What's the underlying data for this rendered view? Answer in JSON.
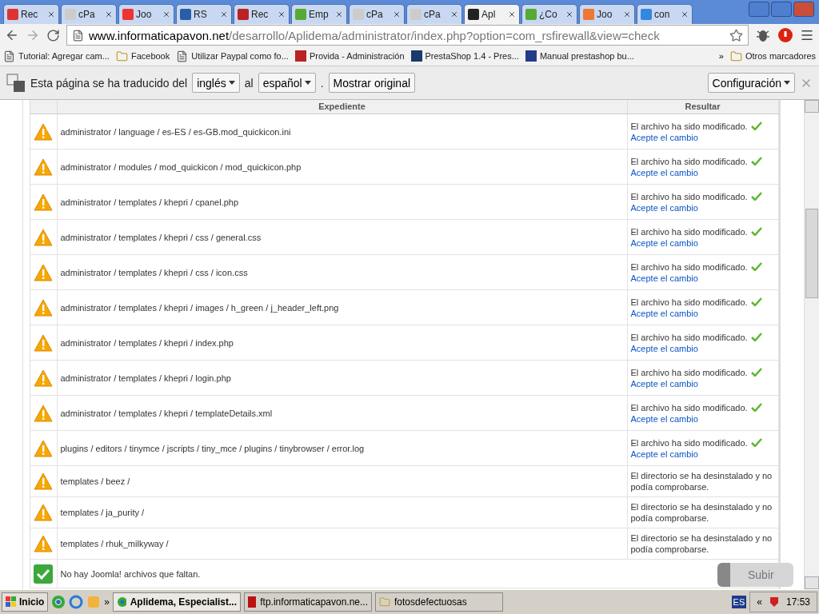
{
  "tabs": [
    {
      "label": "Rec",
      "selected": false
    },
    {
      "label": "cPa",
      "selected": false
    },
    {
      "label": "Joo",
      "selected": false
    },
    {
      "label": "RS",
      "selected": false
    },
    {
      "label": "Rec",
      "selected": false
    },
    {
      "label": "Emp",
      "selected": false
    },
    {
      "label": "cPa",
      "selected": false
    },
    {
      "label": "cPa",
      "selected": false
    },
    {
      "label": "Apl",
      "selected": true
    },
    {
      "label": "¿Co",
      "selected": false
    },
    {
      "label": "Joo",
      "selected": false
    },
    {
      "label": "con",
      "selected": false
    }
  ],
  "address": {
    "host": "www.informaticapavon.net",
    "path": "/desarrollo/Aplidema/administrator/index.php?option=com_rsfirewall&view=check"
  },
  "bookmarks": [
    {
      "label": "Tutorial: Agregar cam...",
      "kind": "page"
    },
    {
      "label": "Facebook",
      "kind": "folder"
    },
    {
      "label": "Utilizar Paypal como fo...",
      "kind": "page"
    },
    {
      "label": "Provida - Administración",
      "kind": "site"
    },
    {
      "label": "PrestaShop 1.4 - Pres...",
      "kind": "site"
    },
    {
      "label": "Manual prestashop bu...",
      "kind": "site"
    }
  ],
  "bookmarks_more": "»",
  "other_bookmarks": "Otros marcadores",
  "translate_bar": {
    "message": "Esta página se ha traducido del",
    "from": "inglés",
    "joiner": "al",
    "to": "español",
    "period": ".",
    "show_original": "Mostrar original",
    "settings": "Configuración"
  },
  "table": {
    "columns": [
      "Expediente",
      "Resultar"
    ],
    "rows": [
      {
        "kind": "modified",
        "file": "administrator / language / es-ES / es-GB.mod_quickicon.ini",
        "result": "El archivo ha sido modificado.",
        "link": "Acepte el cambio"
      },
      {
        "kind": "modified",
        "file": "administrator / modules / mod_quickicon / mod_quickicon.php",
        "result": "El archivo ha sido modificado.",
        "link": "Acepte el cambio"
      },
      {
        "kind": "modified",
        "file": "administrator / templates / khepri / cpanel.php",
        "result": "El archivo ha sido modificado.",
        "link": "Acepte el cambio"
      },
      {
        "kind": "modified",
        "file": "administrator / templates / khepri / css / general.css",
        "result": "El archivo ha sido modificado.",
        "link": "Acepte el cambio"
      },
      {
        "kind": "modified",
        "file": "administrator / templates / khepri / css / icon.css",
        "result": "El archivo ha sido modificado.",
        "link": "Acepte el cambio"
      },
      {
        "kind": "modified",
        "file": "administrator / templates / khepri / images / h_green / j_header_left.png",
        "result": "El archivo ha sido modificado.",
        "link": "Acepte el cambio"
      },
      {
        "kind": "modified",
        "file": "administrator / templates / khepri / index.php",
        "result": "El archivo ha sido modificado.",
        "link": "Acepte el cambio"
      },
      {
        "kind": "modified",
        "file": "administrator / templates / khepri / login.php",
        "result": "El archivo ha sido modificado.",
        "link": "Acepte el cambio"
      },
      {
        "kind": "modified",
        "file": "administrator / templates / khepri / templateDetails.xml",
        "result": "El archivo ha sido modificado.",
        "link": "Acepte el cambio"
      },
      {
        "kind": "modified",
        "file": "plugins / editors / tinymce / jscripts / tiny_mce / plugins / tinybrowser / error.log",
        "result": "El archivo ha sido modificado.",
        "link": "Acepte el cambio"
      },
      {
        "kind": "missing",
        "file": "templates / beez /",
        "result": "El directorio se ha desinstalado y no podía comprobarse."
      },
      {
        "kind": "missing",
        "file": "templates / ja_purity /",
        "result": "El directorio se ha desinstalado y no podía comprobarse."
      },
      {
        "kind": "missing",
        "file": "templates / rhuk_milkyway /",
        "result": "El directorio se ha desinstalado y no podía comprobarse."
      },
      {
        "kind": "ok",
        "file": "No hay Joomla! archivos que faltan."
      }
    ]
  },
  "scroll_top_button": "Subir",
  "taskbar": {
    "start": "Inicio",
    "more": "»",
    "windows": [
      {
        "label": "Aplidema, Especialist...",
        "kind": "chrome",
        "selected": true
      },
      {
        "label": "ftp.informaticapavon.ne...",
        "kind": "ftp",
        "selected": false
      },
      {
        "label": "fotosdefectuosas",
        "kind": "folder",
        "selected": false
      }
    ],
    "language": "ES",
    "tray_more": "«",
    "clock": "17:53"
  }
}
